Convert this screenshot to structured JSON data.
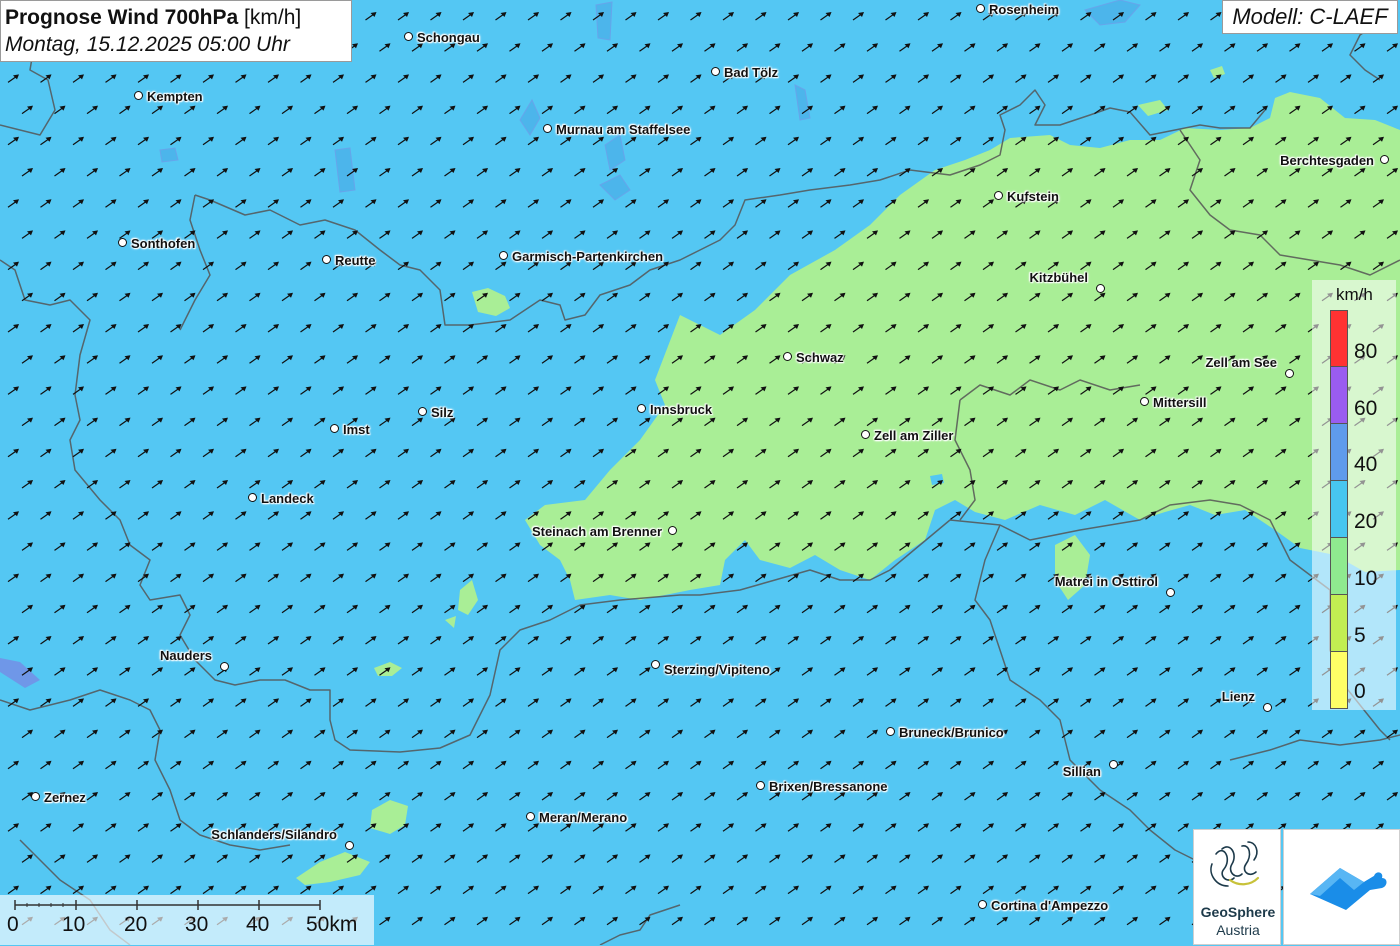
{
  "header": {
    "title_bold": "Prognose Wind 700hPa",
    "title_unit": "[km/h]",
    "datetime": "Montag, 15.12.2025 05:00 Uhr"
  },
  "model": {
    "label": "Modell: C-LAEF"
  },
  "legend": {
    "unit": "km/h",
    "colors": [
      "#ff3232",
      "#9a5cf0",
      "#5f9bec",
      "#47c6f0",
      "#8fea8f",
      "#c2ee52",
      "#ffff66"
    ],
    "ticks": [
      "80",
      "60",
      "40",
      "20",
      "10",
      "5",
      "0"
    ]
  },
  "scale": {
    "labels": [
      "0",
      "10",
      "20",
      "30",
      "40",
      "50km"
    ]
  },
  "wind": {
    "direction": "from southwest (arrows point to the north-east)"
  },
  "colors": {
    "wind_10_20": "#54c7f3",
    "wind_5_10": "#a9ee96"
  },
  "cities": [
    {
      "name": "Rosenheim"
    },
    {
      "name": "Schongau"
    },
    {
      "name": "Bad Tölz"
    },
    {
      "name": "Kempten"
    },
    {
      "name": "Murnau am Staffelsee"
    },
    {
      "name": "Berchtesgaden"
    },
    {
      "name": "Kufstein"
    },
    {
      "name": "Sonthofen"
    },
    {
      "name": "Reutte"
    },
    {
      "name": "Garmisch-Partenkirchen"
    },
    {
      "name": "Kitzbühel"
    },
    {
      "name": "Schwaz"
    },
    {
      "name": "Zell am See"
    },
    {
      "name": "Mittersill"
    },
    {
      "name": "Silz"
    },
    {
      "name": "Innsbruck"
    },
    {
      "name": "Imst"
    },
    {
      "name": "Zell am Ziller"
    },
    {
      "name": "Landeck"
    },
    {
      "name": "Steinach am Brenner"
    },
    {
      "name": "Matrei in Osttirol"
    },
    {
      "name": "Nauders"
    },
    {
      "name": "Sterzing/Vipiteno"
    },
    {
      "name": "Lienz"
    },
    {
      "name": "Bruneck/Brunico"
    },
    {
      "name": "Sillian"
    },
    {
      "name": "Brixen/Bressanone"
    },
    {
      "name": "Zernez"
    },
    {
      "name": "Meran/Merano"
    },
    {
      "name": "Schlanders/Silandro"
    },
    {
      "name": "Cortina d'Ampezzo"
    }
  ],
  "logos": {
    "geosphere_line1": "GeoSphere",
    "geosphere_line2": "Austria"
  }
}
